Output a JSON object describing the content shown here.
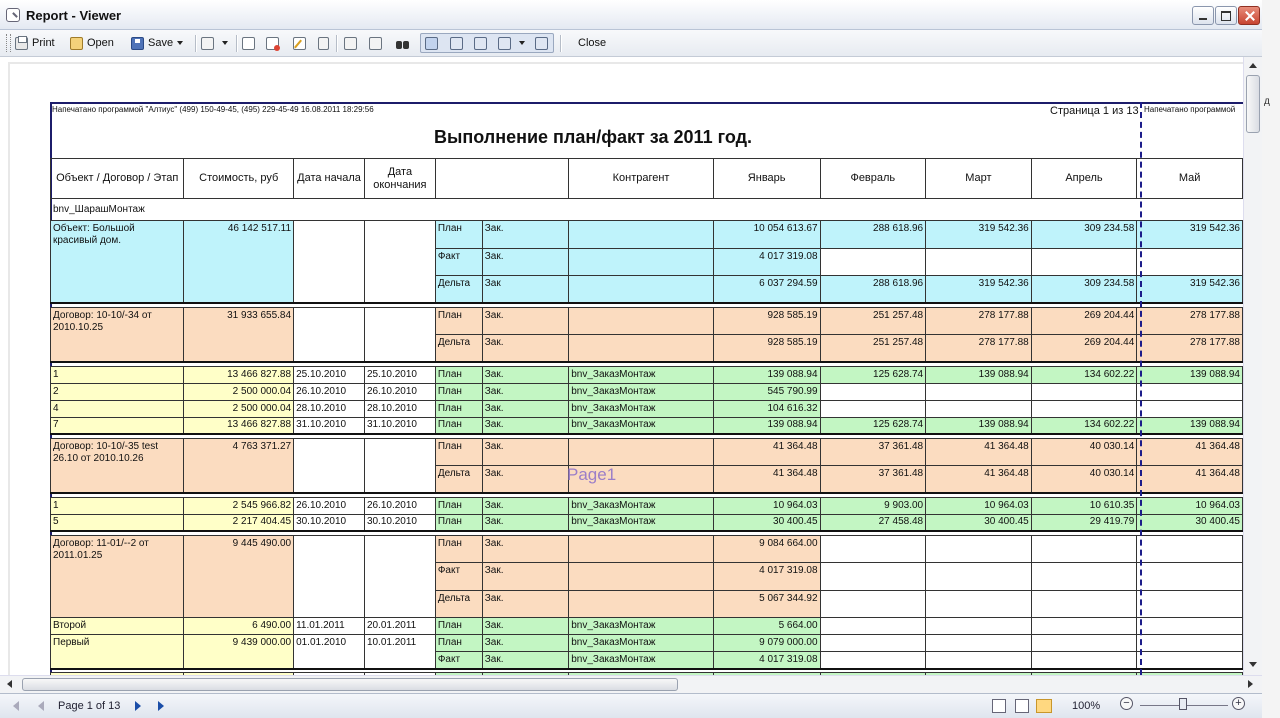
{
  "window": {
    "title": "Report - Viewer"
  },
  "toolbar": {
    "print_label": "Print",
    "open_label": "Open",
    "save_label": "Save",
    "close_label": "Close"
  },
  "report": {
    "printed_by": "Напечатано программой \"Алтиус\" (499) 150-49-45, (495) 229-45-49   16.08.2011  18:29:56",
    "printed_by_next": "Напечатано программой",
    "page_of": "Страница 1 из 13",
    "title": "Выполнение план/факт за 2011 год.",
    "watermark": "Page1",
    "headers": {
      "object": "Объект / Договор / Этап",
      "cost": "Стоимость, руб",
      "start": "Дата начала",
      "end": "Дата окончания",
      "contractor": "Контрагент",
      "jan": "Январь",
      "feb": "Февраль",
      "mar": "Март",
      "apr": "Апрель",
      "may": "Май"
    },
    "group_label": "bnv_ШарашМонтаж",
    "object_row": {
      "name": "Объект: Большой красивый дом.",
      "cost": "46 142 517.11",
      "lines": [
        {
          "type": "План",
          "kind": "Зак.",
          "jan": "10 054 613.67",
          "feb": "288 618.96",
          "mar": "319 542.36",
          "apr": "309 234.58",
          "may": "319 542.36"
        },
        {
          "type": "Факт",
          "kind": "Зак.",
          "jan": "4 017 319.08",
          "feb": "",
          "mar": "",
          "apr": "",
          "may": ""
        },
        {
          "type": "Дельта",
          "kind": "Зак",
          "jan": "6 037 294.59",
          "feb": "288 618.96",
          "mar": "319 542.36",
          "apr": "309 234.58",
          "may": "319 542.36"
        }
      ]
    },
    "contract1": {
      "name": "Договор: 10-10/-34 от 2010.10.25",
      "cost": "31 933 655.84",
      "lines": [
        {
          "type": "План",
          "kind": "Зак.",
          "jan": "928 585.19",
          "feb": "251 257.48",
          "mar": "278 177.88",
          "apr": "269 204.44",
          "may": "278 177.88"
        },
        {
          "type": "Дельта",
          "kind": "Зак.",
          "jan": "928 585.19",
          "feb": "251 257.48",
          "mar": "278 177.88",
          "apr": "269 204.44",
          "may": "278 177.88"
        }
      ],
      "stages": [
        {
          "name": "1",
          "cost": "13 466 827.88",
          "start": "25.10.2010",
          "end": "25.10.2010",
          "type": "План",
          "kind": "Зак.",
          "contractor": "bnv_ЗаказМонтаж",
          "jan": "139 088.94",
          "feb": "125 628.74",
          "mar": "139 088.94",
          "apr": "134 602.22",
          "may": "139 088.94"
        },
        {
          "name": "2",
          "cost": "2 500 000.04",
          "start": "26.10.2010",
          "end": "26.10.2010",
          "type": "План",
          "kind": "Зак.",
          "contractor": "bnv_ЗаказМонтаж",
          "jan": "545 790.99",
          "feb": "",
          "mar": "",
          "apr": "",
          "may": ""
        },
        {
          "name": "4",
          "cost": "2 500 000.04",
          "start": "28.10.2010",
          "end": "28.10.2010",
          "type": "План",
          "kind": "Зак.",
          "contractor": "bnv_ЗаказМонтаж",
          "jan": "104 616.32",
          "feb": "",
          "mar": "",
          "apr": "",
          "may": ""
        },
        {
          "name": "7",
          "cost": "13 466 827.88",
          "start": "31.10.2010",
          "end": "31.10.2010",
          "type": "План",
          "kind": "Зак.",
          "contractor": "bnv_ЗаказМонтаж",
          "jan": "139 088.94",
          "feb": "125 628.74",
          "mar": "139 088.94",
          "apr": "134 602.22",
          "may": "139 088.94"
        }
      ]
    },
    "contract2": {
      "name": "Договор: 10-10/-35 test 26.10 от 2010.10.26",
      "cost": "4 763 371.27",
      "lines": [
        {
          "type": "План",
          "kind": "Зак.",
          "jan": "41 364.48",
          "feb": "37 361.48",
          "mar": "41 364.48",
          "apr": "40 030.14",
          "may": "41 364.48"
        },
        {
          "type": "Дельта",
          "kind": "Зак.",
          "jan": "41 364.48",
          "feb": "37 361.48",
          "mar": "41 364.48",
          "apr": "40 030.14",
          "may": "41 364.48"
        }
      ],
      "stages": [
        {
          "name": "1",
          "cost": "2 545 966.82",
          "start": "26.10.2010",
          "end": "26.10.2010",
          "type": "План",
          "kind": "Зак.",
          "contractor": "bnv_ЗаказМонтаж",
          "jan": "10 964.03",
          "feb": "9 903.00",
          "mar": "10 964.03",
          "apr": "10 610.35",
          "may": "10 964.03"
        },
        {
          "name": "5",
          "cost": "2 217 404.45",
          "start": "30.10.2010",
          "end": "30.10.2010",
          "type": "План",
          "kind": "Зак.",
          "contractor": "bnv_ЗаказМонтаж",
          "jan": "30 400.45",
          "feb": "27 458.48",
          "mar": "30 400.45",
          "apr": "29 419.79",
          "may": "30 400.45"
        }
      ]
    },
    "contract3": {
      "name": "Договор: 11-01/--2 от 2011.01.25",
      "cost": "9 445 490.00",
      "lines": [
        {
          "type": "План",
          "kind": "Зак.",
          "jan": "9 084 664.00"
        },
        {
          "type": "Факт",
          "kind": "Зак.",
          "jan": "4 017 319.08"
        },
        {
          "type": "Дельта",
          "kind": "Зак.",
          "jan": "5 067 344.92"
        }
      ],
      "stages": [
        {
          "name": "Второй",
          "cost": "6 490.00",
          "start": "11.01.2011",
          "end": "20.01.2011",
          "type": "План",
          "kind": "Зак.",
          "contractor": "bnv_ЗаказМонтаж",
          "jan": "5 664.00"
        },
        {
          "name": "Первый",
          "cost": "9 439 000.00",
          "start": "01.01.2010",
          "end": "10.01.2011",
          "type": "План",
          "kind": "Зак.",
          "contractor": "bnv_ЗаказМонтаж",
          "jan": "9 079 000.00"
        },
        {
          "name": "",
          "cost": "",
          "start": "",
          "end": "",
          "type": "Факт",
          "kind": "Зак.",
          "contractor": "bnv_ЗаказМонтаж",
          "jan": "4 017 319.08"
        }
      ]
    }
  },
  "status": {
    "page_label": "Page 1 of 13",
    "zoom_label": "100%",
    "zoom_minus": "−",
    "zoom_plus": "+",
    "side_letter": "д"
  },
  "colors": {
    "cyan": "#bff3fb",
    "orange": "#fbdcc0",
    "yellow": "#ffffc8",
    "green": "#c3f6c3",
    "border_blue": "#1c1c6a",
    "watermark": "#9b7ec8"
  }
}
